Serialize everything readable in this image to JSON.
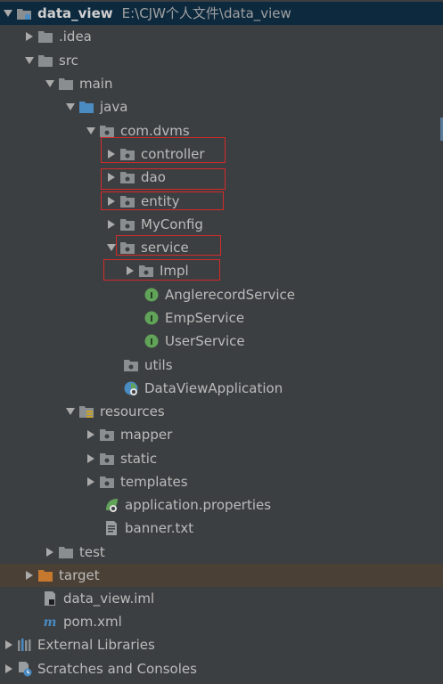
{
  "tree": {
    "root_name": "data_view",
    "root_path": "E:\\CJW个人文件\\data_view",
    "idea": ".idea",
    "src": "src",
    "main": "main",
    "java": "java",
    "package": "com.dvms",
    "controller": "controller",
    "dao": "dao",
    "entity": "entity",
    "myconfig": "MyConfig",
    "service": "service",
    "impl": "Impl",
    "anglerecord_service": "AnglerecordService",
    "emp_service": "EmpService",
    "user_service": "UserService",
    "utils": "utils",
    "app_class": "DataViewApplication",
    "resources": "resources",
    "mapper": "mapper",
    "static": "static",
    "templates": "templates",
    "app_properties": "application.properties",
    "banner": "banner.txt",
    "test": "test",
    "target": "target",
    "iml": "data_view.iml",
    "pom": "pom.xml",
    "external_libraries": "External Libraries",
    "scratches": "Scratches and Consoles"
  },
  "colors": {
    "background": "#3c3f41",
    "selection": "#0d293e",
    "excluded": "#4a4035",
    "highlight_box": "#d32a2a",
    "interface_icon": "#62a35a",
    "folder": "#8a8e91",
    "source_folder": "#4a8bc2",
    "target_folder": "#c6782f"
  }
}
